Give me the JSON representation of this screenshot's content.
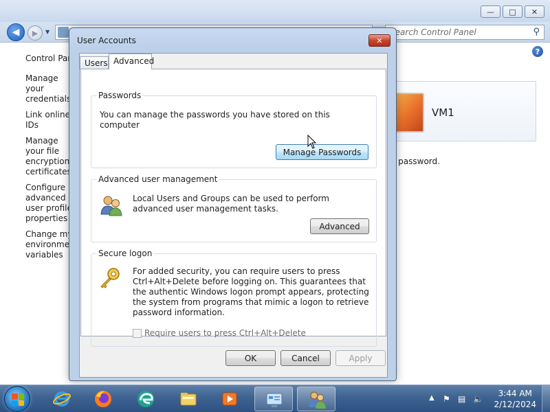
{
  "background_window": {
    "search": {
      "placeholder": "Search Control Panel"
    },
    "left_nav": {
      "home": "Control Panel Home",
      "links": [
        "Manage your credentials",
        "Link online IDs",
        "Manage your file encryption certificates",
        "Configure advanced user profile properties",
        "Change my environment variables"
      ]
    },
    "user": {
      "name": "VM1"
    },
    "password_text": "a password."
  },
  "dialog": {
    "title": "User Accounts",
    "tabs": [
      {
        "label": "Users",
        "selected": false
      },
      {
        "label": "Advanced",
        "selected": true
      }
    ],
    "passwords": {
      "label": "Passwords",
      "text": "You can manage the passwords you have stored on this computer",
      "button": "Manage Passwords"
    },
    "advanced_user_management": {
      "label": "Advanced user management",
      "text": "Local Users and Groups can be used to perform advanced user management tasks.",
      "button": "Advanced"
    },
    "secure_logon": {
      "label": "Secure logon",
      "text": "For added security, you can require users to press Ctrl+Alt+Delete before logging on. This guarantees that the authentic Windows logon prompt appears, protecting the system from programs that mimic a logon to retrieve password information.",
      "checkbox_label": "Require users to press Ctrl+Alt+Delete",
      "checkbox_checked": false,
      "checkbox_enabled": false
    },
    "buttons": {
      "ok": "OK",
      "cancel": "Cancel",
      "apply": "Apply"
    }
  },
  "taskbar": {
    "items": [
      "internet-explorer-icon",
      "firefox-icon",
      "edge-icon",
      "file-explorer-icon",
      "media-player-icon",
      "control-panel-icon",
      "user-accounts-icon"
    ],
    "clock": {
      "time": "3:44 AM",
      "date": "2/12/2024"
    }
  },
  "colors": {
    "titlebar": "#c9daf0",
    "taskbar": "#3e6391",
    "accent": "#3c7fb1",
    "close": "#c8442d"
  }
}
